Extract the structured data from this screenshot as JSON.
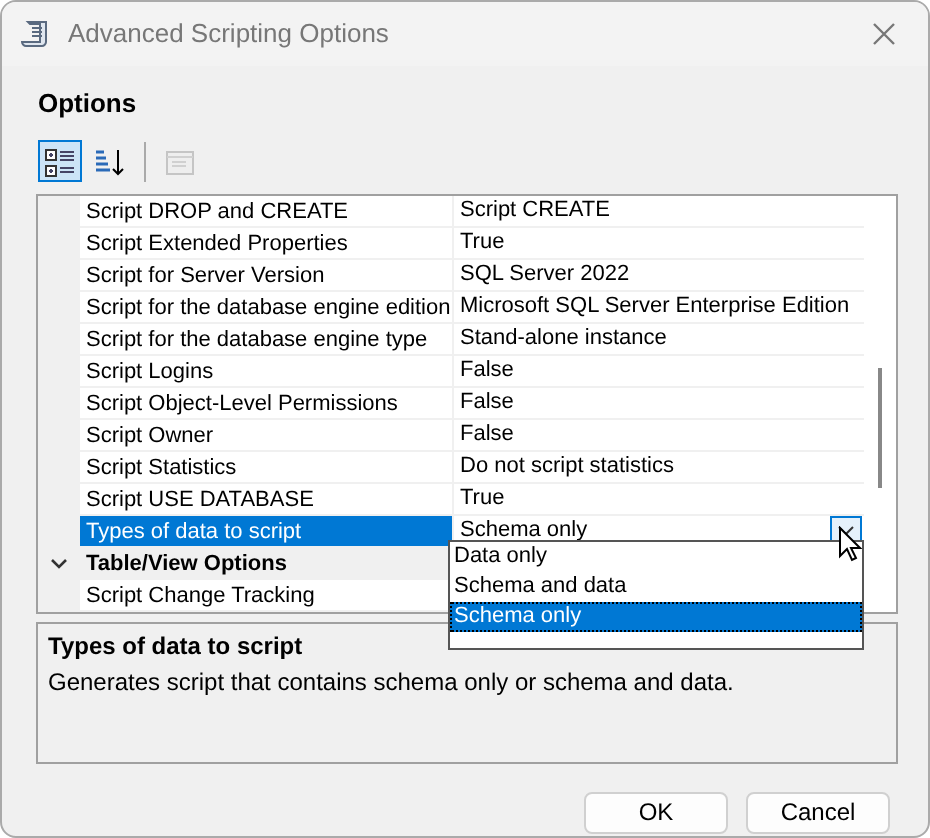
{
  "window": {
    "title": "Advanced Scripting Options"
  },
  "section_title": "Options",
  "toolbar": [
    {
      "kind": "categorized",
      "selected": true,
      "disabled": false
    },
    {
      "kind": "alphabetical",
      "selected": false,
      "disabled": false
    },
    {
      "kind": "property-pages",
      "selected": false,
      "disabled": true
    }
  ],
  "properties": [
    {
      "kind": "property",
      "name": "Script DROP and CREATE",
      "value": "Script CREATE",
      "selected": false
    },
    {
      "kind": "property",
      "name": "Script Extended Properties",
      "value": "True",
      "selected": false
    },
    {
      "kind": "property",
      "name": "Script for Server Version",
      "value": "SQL Server 2022",
      "selected": false
    },
    {
      "kind": "property",
      "name": "Script for the database engine edition",
      "value": "Microsoft SQL Server Enterprise Edition",
      "selected": false
    },
    {
      "kind": "property",
      "name": "Script for the database engine type",
      "value": "Stand-alone instance",
      "selected": false
    },
    {
      "kind": "property",
      "name": "Script Logins",
      "value": "False",
      "selected": false
    },
    {
      "kind": "property",
      "name": "Script Object-Level Permissions",
      "value": "False",
      "selected": false
    },
    {
      "kind": "property",
      "name": "Script Owner",
      "value": "False",
      "selected": false
    },
    {
      "kind": "property",
      "name": "Script Statistics",
      "value": "Do not script statistics",
      "selected": false
    },
    {
      "kind": "property",
      "name": "Script USE DATABASE",
      "value": "True",
      "selected": false
    },
    {
      "kind": "property",
      "name": "Types of data to script",
      "value": "Schema only",
      "selected": true
    },
    {
      "kind": "category",
      "name": "Table/View Options",
      "expanded": true
    },
    {
      "kind": "property",
      "name": "Script Change Tracking",
      "selected": false
    }
  ],
  "dropdown": {
    "options": [
      {
        "label": "Data only",
        "selected": false
      },
      {
        "label": "Schema and data",
        "selected": false
      },
      {
        "label": "Schema only",
        "selected": true
      }
    ]
  },
  "description": {
    "title": "Types of data to script",
    "text": "Generates script that contains schema only or schema and data."
  },
  "buttons": [
    "OK",
    "Cancel"
  ]
}
